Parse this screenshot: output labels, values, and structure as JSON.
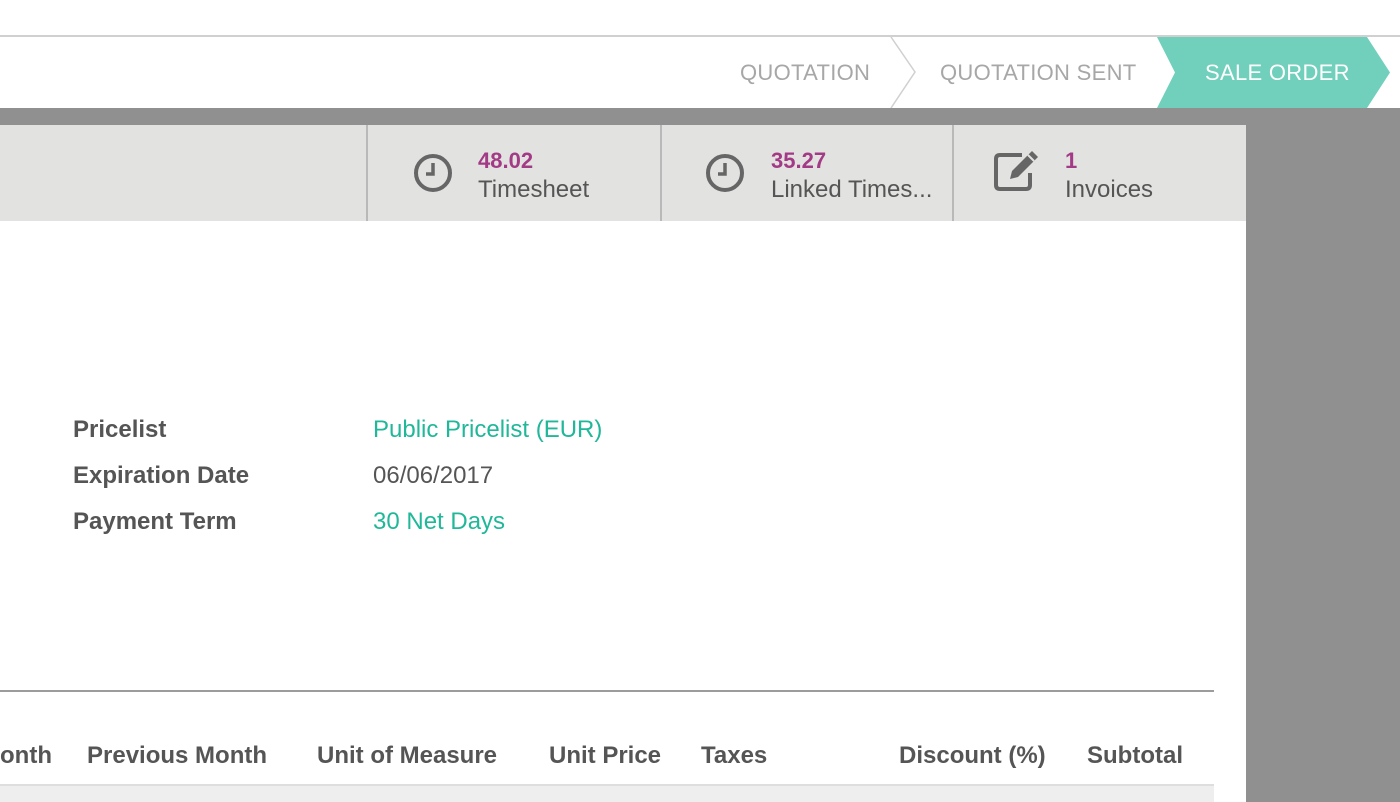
{
  "status": {
    "stages": [
      "QUOTATION",
      "QUOTATION SENT"
    ],
    "active_stage": "SALE ORDER",
    "active_color": "#71d0bb"
  },
  "stat_buttons": [
    {
      "value": "48.02",
      "label": "Timesheet",
      "icon": "clock-icon"
    },
    {
      "value": "35.27",
      "label": "Linked Times...",
      "icon": "clock-icon"
    },
    {
      "value": "1",
      "label": "Invoices",
      "icon": "pencil-square-icon"
    }
  ],
  "fields": [
    {
      "label": "Pricelist",
      "value": "Public Pricelist (EUR)"
    },
    {
      "label": "Expiration Date",
      "value": "06/06/2017"
    },
    {
      "label": "Payment Term",
      "value": "30 Net Days"
    }
  ],
  "table": {
    "columns": [
      "onth",
      "Previous Month",
      "Unit of Measure",
      "Unit Price",
      "Taxes",
      "Discount (%)",
      "Subtotal"
    ]
  },
  "colors": {
    "accent_purple": "#a33a86",
    "link_green": "#21b799"
  }
}
